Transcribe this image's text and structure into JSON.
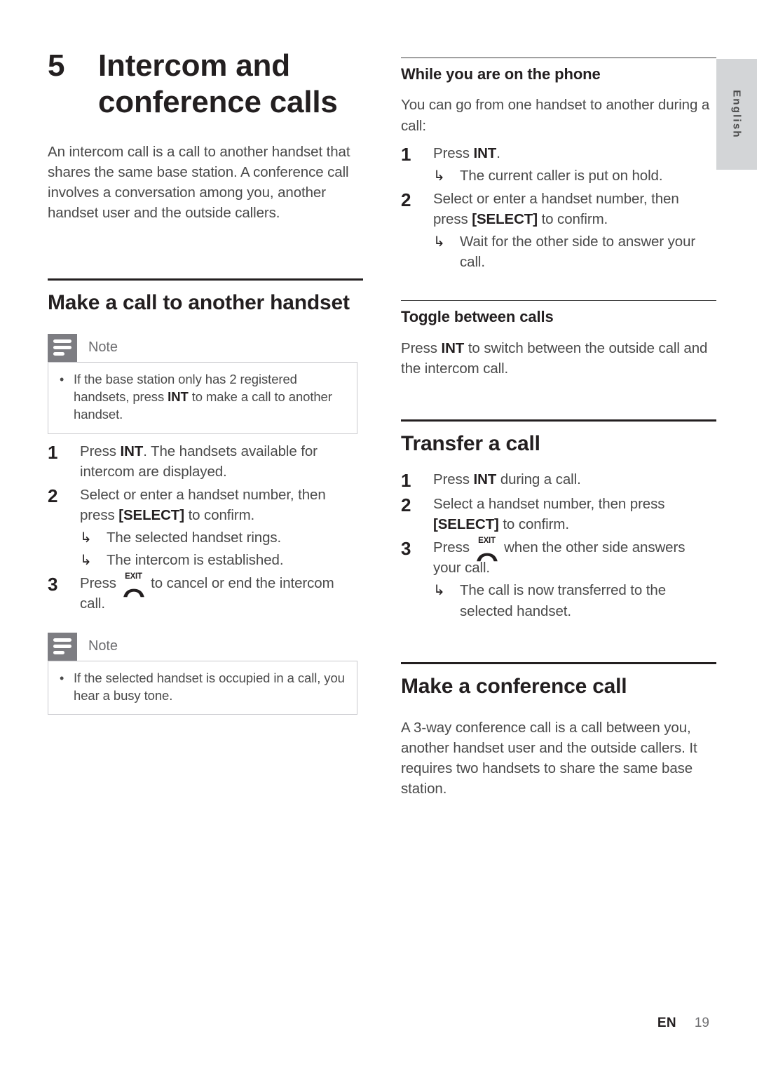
{
  "page": {
    "chapter_number": "5",
    "chapter_title": "Intercom and conference calls",
    "intro": "An intercom call is a call to another handset that shares the same base station. A conference call involves a conversation among you, another handset user and the outside callers.",
    "language_tab": "English",
    "footer_locale": "EN",
    "footer_page": "19"
  },
  "icons": {
    "note_icon": "lines-note-icon",
    "exit_key_label": "EXIT",
    "exit_key_icon": "phone-hangup-icon",
    "result_arrow": "↳",
    "bullet": "•"
  },
  "left_column": {
    "section": {
      "heading": "Make a call to another handset",
      "note_1": {
        "title": "Note",
        "items": [
          {
            "pre": "If the base station only has 2 registered handsets, press ",
            "keyword": "INT",
            "post": " to make a call to another handset."
          }
        ]
      },
      "steps": [
        {
          "num": "1",
          "pre": "Press ",
          "keyword": "INT",
          "post": ". The handsets available for intercom are displayed.",
          "results": []
        },
        {
          "num": "2",
          "pre": "Select or enter a handset number, then press ",
          "keyword": "[SELECT]",
          "post": " to confirm.",
          "results": [
            "The selected handset rings.",
            "The intercom is established."
          ]
        },
        {
          "num": "3",
          "pre": "Press ",
          "keyword": "",
          "post": " to cancel or end the intercom call.",
          "has_exit_key": true,
          "results": []
        }
      ],
      "note_2": {
        "title": "Note",
        "items": [
          {
            "pre": "If the selected handset is occupied in a call, you hear a busy tone.",
            "keyword": "",
            "post": ""
          }
        ]
      }
    }
  },
  "right_column": {
    "subsection_phone": {
      "heading": "While you are on the phone",
      "body": "You can go from one handset to another during a call:",
      "steps": [
        {
          "num": "1",
          "pre": "Press ",
          "keyword": "INT",
          "post": ".",
          "results": [
            "The current caller is put on hold."
          ]
        },
        {
          "num": "2",
          "pre": "Select or enter a handset number, then press ",
          "keyword": "[SELECT]",
          "post": " to confirm.",
          "results": [
            "Wait for the other side to answer your call."
          ]
        }
      ]
    },
    "subsection_toggle": {
      "heading": "Toggle between calls",
      "body_pre": "Press ",
      "body_keyword": "INT",
      "body_post": " to switch between the outside call and the intercom call."
    },
    "section_transfer": {
      "heading": "Transfer a call",
      "steps": [
        {
          "num": "1",
          "pre": "Press ",
          "keyword": "INT",
          "post": " during a call.",
          "results": []
        },
        {
          "num": "2",
          "pre": "Select a handset number, then press ",
          "keyword": "[SELECT]",
          "post": " to confirm.",
          "results": []
        },
        {
          "num": "3",
          "pre": "Press ",
          "keyword": "",
          "post": " when the other side answers your call.",
          "has_exit_key": true,
          "results": [
            "The call is now transferred to the selected handset."
          ]
        }
      ]
    },
    "section_conference": {
      "heading": "Make a conference call",
      "body": "A 3-way conference call is a call between you, another handset user and the outside callers. It requires two handsets to share the same base station."
    }
  }
}
